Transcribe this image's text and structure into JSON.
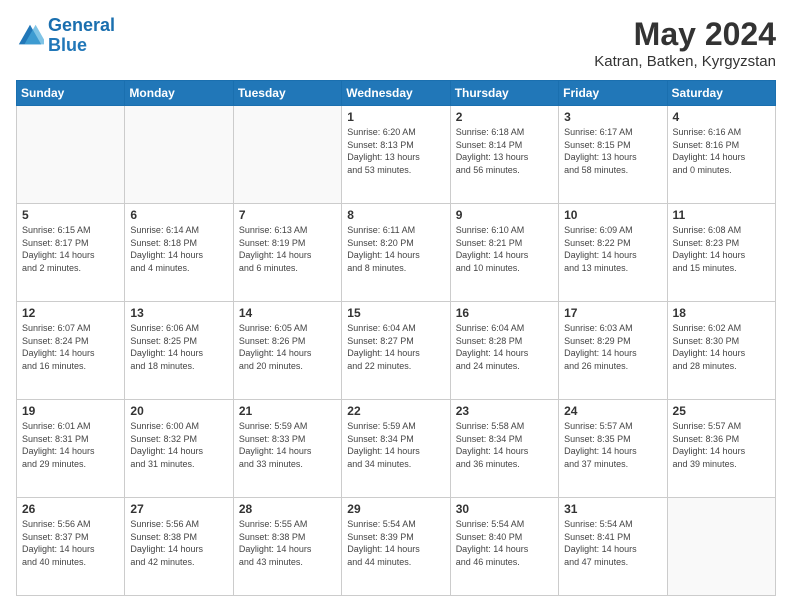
{
  "header": {
    "logo_line1": "General",
    "logo_line2": "Blue",
    "title": "May 2024",
    "subtitle": "Katran, Batken, Kyrgyzstan"
  },
  "days_of_week": [
    "Sunday",
    "Monday",
    "Tuesday",
    "Wednesday",
    "Thursday",
    "Friday",
    "Saturday"
  ],
  "weeks": [
    [
      {
        "day": "",
        "info": ""
      },
      {
        "day": "",
        "info": ""
      },
      {
        "day": "",
        "info": ""
      },
      {
        "day": "1",
        "info": "Sunrise: 6:20 AM\nSunset: 8:13 PM\nDaylight: 13 hours\nand 53 minutes."
      },
      {
        "day": "2",
        "info": "Sunrise: 6:18 AM\nSunset: 8:14 PM\nDaylight: 13 hours\nand 56 minutes."
      },
      {
        "day": "3",
        "info": "Sunrise: 6:17 AM\nSunset: 8:15 PM\nDaylight: 13 hours\nand 58 minutes."
      },
      {
        "day": "4",
        "info": "Sunrise: 6:16 AM\nSunset: 8:16 PM\nDaylight: 14 hours\nand 0 minutes."
      }
    ],
    [
      {
        "day": "5",
        "info": "Sunrise: 6:15 AM\nSunset: 8:17 PM\nDaylight: 14 hours\nand 2 minutes."
      },
      {
        "day": "6",
        "info": "Sunrise: 6:14 AM\nSunset: 8:18 PM\nDaylight: 14 hours\nand 4 minutes."
      },
      {
        "day": "7",
        "info": "Sunrise: 6:13 AM\nSunset: 8:19 PM\nDaylight: 14 hours\nand 6 minutes."
      },
      {
        "day": "8",
        "info": "Sunrise: 6:11 AM\nSunset: 8:20 PM\nDaylight: 14 hours\nand 8 minutes."
      },
      {
        "day": "9",
        "info": "Sunrise: 6:10 AM\nSunset: 8:21 PM\nDaylight: 14 hours\nand 10 minutes."
      },
      {
        "day": "10",
        "info": "Sunrise: 6:09 AM\nSunset: 8:22 PM\nDaylight: 14 hours\nand 13 minutes."
      },
      {
        "day": "11",
        "info": "Sunrise: 6:08 AM\nSunset: 8:23 PM\nDaylight: 14 hours\nand 15 minutes."
      }
    ],
    [
      {
        "day": "12",
        "info": "Sunrise: 6:07 AM\nSunset: 8:24 PM\nDaylight: 14 hours\nand 16 minutes."
      },
      {
        "day": "13",
        "info": "Sunrise: 6:06 AM\nSunset: 8:25 PM\nDaylight: 14 hours\nand 18 minutes."
      },
      {
        "day": "14",
        "info": "Sunrise: 6:05 AM\nSunset: 8:26 PM\nDaylight: 14 hours\nand 20 minutes."
      },
      {
        "day": "15",
        "info": "Sunrise: 6:04 AM\nSunset: 8:27 PM\nDaylight: 14 hours\nand 22 minutes."
      },
      {
        "day": "16",
        "info": "Sunrise: 6:04 AM\nSunset: 8:28 PM\nDaylight: 14 hours\nand 24 minutes."
      },
      {
        "day": "17",
        "info": "Sunrise: 6:03 AM\nSunset: 8:29 PM\nDaylight: 14 hours\nand 26 minutes."
      },
      {
        "day": "18",
        "info": "Sunrise: 6:02 AM\nSunset: 8:30 PM\nDaylight: 14 hours\nand 28 minutes."
      }
    ],
    [
      {
        "day": "19",
        "info": "Sunrise: 6:01 AM\nSunset: 8:31 PM\nDaylight: 14 hours\nand 29 minutes."
      },
      {
        "day": "20",
        "info": "Sunrise: 6:00 AM\nSunset: 8:32 PM\nDaylight: 14 hours\nand 31 minutes."
      },
      {
        "day": "21",
        "info": "Sunrise: 5:59 AM\nSunset: 8:33 PM\nDaylight: 14 hours\nand 33 minutes."
      },
      {
        "day": "22",
        "info": "Sunrise: 5:59 AM\nSunset: 8:34 PM\nDaylight: 14 hours\nand 34 minutes."
      },
      {
        "day": "23",
        "info": "Sunrise: 5:58 AM\nSunset: 8:34 PM\nDaylight: 14 hours\nand 36 minutes."
      },
      {
        "day": "24",
        "info": "Sunrise: 5:57 AM\nSunset: 8:35 PM\nDaylight: 14 hours\nand 37 minutes."
      },
      {
        "day": "25",
        "info": "Sunrise: 5:57 AM\nSunset: 8:36 PM\nDaylight: 14 hours\nand 39 minutes."
      }
    ],
    [
      {
        "day": "26",
        "info": "Sunrise: 5:56 AM\nSunset: 8:37 PM\nDaylight: 14 hours\nand 40 minutes."
      },
      {
        "day": "27",
        "info": "Sunrise: 5:56 AM\nSunset: 8:38 PM\nDaylight: 14 hours\nand 42 minutes."
      },
      {
        "day": "28",
        "info": "Sunrise: 5:55 AM\nSunset: 8:38 PM\nDaylight: 14 hours\nand 43 minutes."
      },
      {
        "day": "29",
        "info": "Sunrise: 5:54 AM\nSunset: 8:39 PM\nDaylight: 14 hours\nand 44 minutes."
      },
      {
        "day": "30",
        "info": "Sunrise: 5:54 AM\nSunset: 8:40 PM\nDaylight: 14 hours\nand 46 minutes."
      },
      {
        "day": "31",
        "info": "Sunrise: 5:54 AM\nSunset: 8:41 PM\nDaylight: 14 hours\nand 47 minutes."
      },
      {
        "day": "",
        "info": ""
      }
    ]
  ]
}
